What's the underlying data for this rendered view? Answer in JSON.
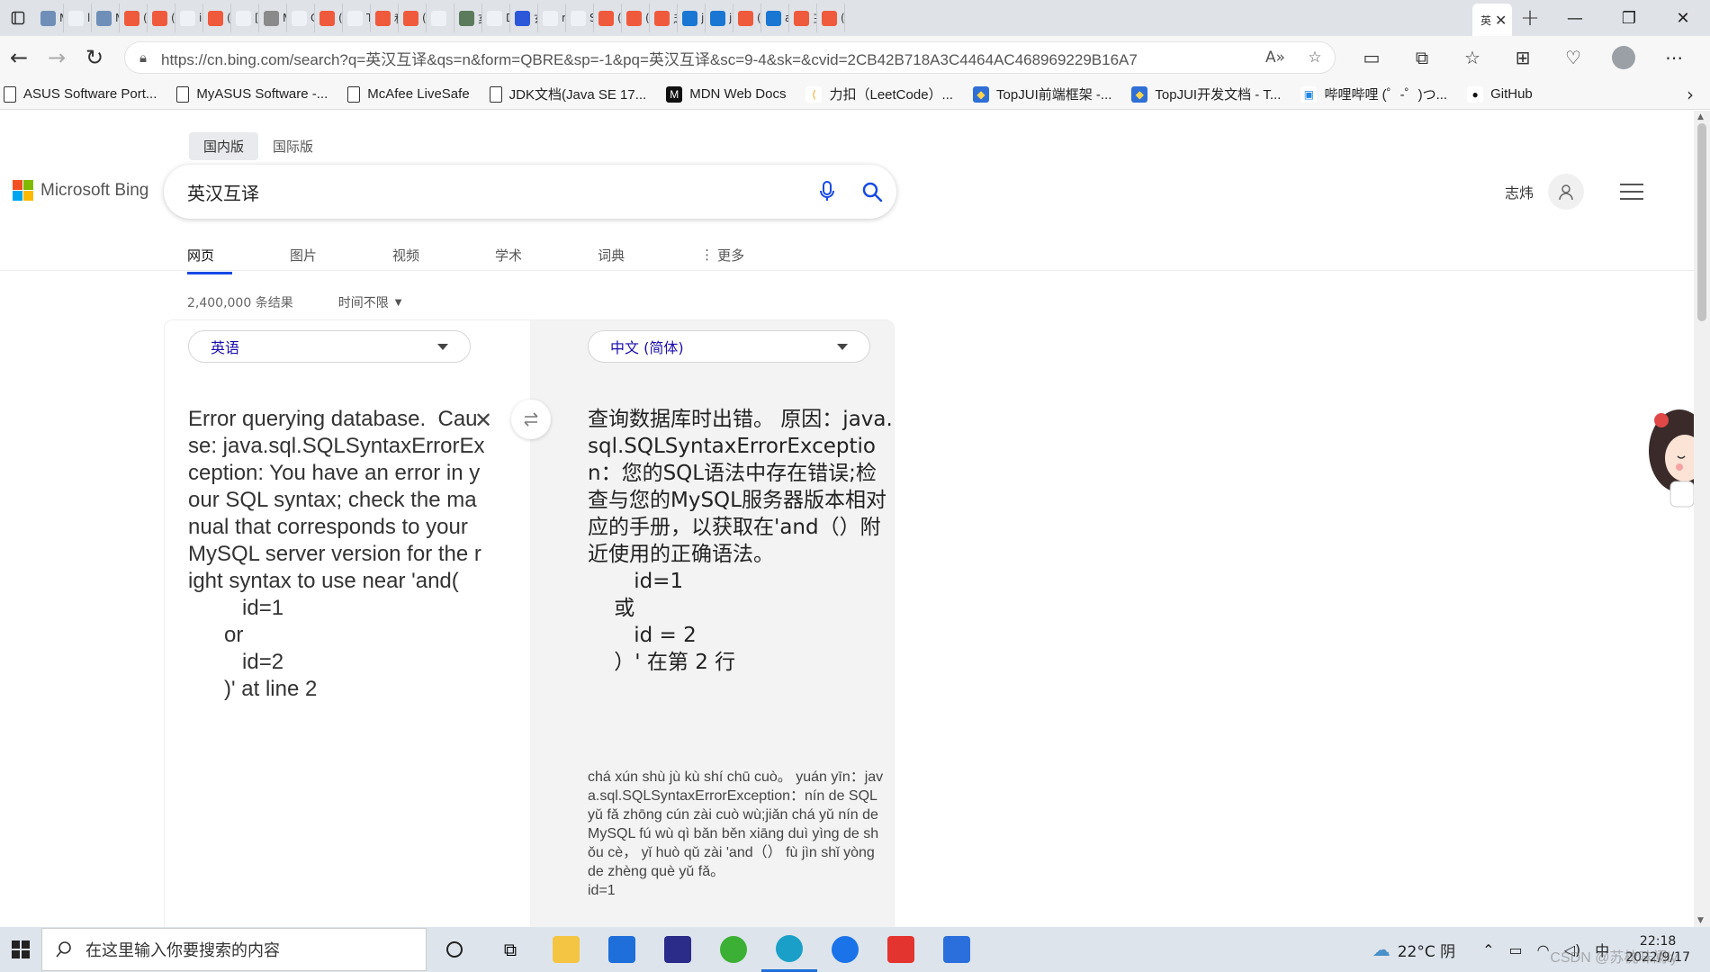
{
  "browser": {
    "url": "https://cn.bing.com/search?q=英汉互译&qs=n&form=QBRE&sp=-1&pq=英汉互译&sc=9-4&sk=&cvid=2CB42B718A3C4464AC468969229B16A7",
    "tabs": [
      {
        "fav": "#6f8fb8",
        "text": "M"
      },
      {
        "fav": "#eef2f6",
        "text": "lc"
      },
      {
        "fav": "#6f8fb8",
        "text": "M"
      },
      {
        "fav": "#f05a3c",
        "text": "("
      },
      {
        "fav": "#f05a3c",
        "text": "("
      },
      {
        "fav": "#eef2f6",
        "text": "ir"
      },
      {
        "fav": "#f05a3c",
        "text": "("
      },
      {
        "fav": "#eef2f6",
        "text": "["
      },
      {
        "fav": "#8a8a8a",
        "text": "M"
      },
      {
        "fav": "#eef2f6",
        "text": "C"
      },
      {
        "fav": "#f05a3c",
        "text": "("
      },
      {
        "fav": "#eef2f6",
        "text": "T"
      },
      {
        "fav": "#f05a3c",
        "text": "私"
      },
      {
        "fav": "#f05a3c",
        "text": "("
      },
      {
        "fav": "#eef2f6",
        "text": ""
      },
      {
        "fav": "#5c7a5c",
        "text": "亥"
      },
      {
        "fav": "#eef2f6",
        "text": "D"
      },
      {
        "fav": "#2b57d8",
        "text": "玄"
      },
      {
        "fav": "#eef2f6",
        "text": "n"
      },
      {
        "fav": "#eef2f6",
        "text": "S"
      },
      {
        "fav": "#f05a3c",
        "text": "("
      },
      {
        "fav": "#f05a3c",
        "text": "("
      },
      {
        "fav": "#f05a3c",
        "text": "乏"
      },
      {
        "fav": "#1976d2",
        "text": "ja"
      },
      {
        "fav": "#1976d2",
        "text": "ja"
      },
      {
        "fav": "#f05a3c",
        "text": "("
      },
      {
        "fav": "#1976d2",
        "text": "a"
      },
      {
        "fav": "#f05a3c",
        "text": "彐"
      },
      {
        "fav": "#f05a3c",
        "text": "("
      }
    ],
    "active_tab": {
      "text": "英"
    },
    "bookmarks": [
      {
        "label": "ASUS Software Port...",
        "kind": "doc"
      },
      {
        "label": "MyASUS Software -...",
        "kind": "doc"
      },
      {
        "label": "McAfee LiveSafe",
        "kind": "doc"
      },
      {
        "label": "JDK文档(Java SE 17...",
        "kind": "doc"
      },
      {
        "label": "MDN Web Docs",
        "kind": "mdn"
      },
      {
        "label": "力扣（LeetCode）...",
        "kind": "leetcode"
      },
      {
        "label": "TopJUI前端框架 -...",
        "kind": "topjui"
      },
      {
        "label": "TopJUI开发文档 - T...",
        "kind": "topjui"
      },
      {
        "label": "哔哩哔哩 (゜-゜)つ...",
        "kind": "bili"
      },
      {
        "label": "GitHub",
        "kind": "github"
      }
    ]
  },
  "bing": {
    "scope_tabs": [
      "国内版",
      "国际版"
    ],
    "logo_text": "Microsoft Bing",
    "query": "英汉互译",
    "username": "志炜",
    "vertical_tabs": [
      "网页",
      "图片",
      "视频",
      "学术",
      "词典",
      "更多"
    ],
    "result_count": "2,400,000 条结果",
    "time_filter": "时间不限"
  },
  "translator": {
    "source_lang": "英语",
    "target_lang": "中文 (简体)",
    "source_text": "Error querying database.  Cause: java.sql.SQLSyntaxErrorException: You have an error in your SQL syntax; check the manual that corresponds to your MySQL server version for the right syntax to use near 'and(\n         id=1\n      or\n         id=2\n      )' at line 2",
    "target_text": "查询数据库时出错。 原因：java.sql.SQLSyntaxErrorException：您的SQL语法中存在错误;检查与您的MySQL服务器版本相对应的手册，以获取在'and（）附近使用的正确语法。\n       id=1\n    或\n       id = 2\n    ）' 在第 2 行",
    "pinyin": "chá xún shù jù kù shí chū cuò。 yuán yīn：java.sql.SQLSyntaxErrorException：nín de SQL yǔ fǎ zhōng cún zài cuò wù;jiǎn chá yǔ nín de MySQL fú wù qì bǎn běn xiāng duì yìng de shǒu cè， yǐ huò qǔ zài 'and（） fù jìn shǐ yòng de zhèng què yǔ fǎ。\nid=1"
  },
  "taskbar": {
    "search_placeholder": "在这里输入你要搜索的内容",
    "weather": "22°C 阴",
    "ime": "中",
    "time": "22:18",
    "date": "2022/9/17",
    "watermark": "CSDN @苏枕味阑ly"
  },
  "colors": {
    "bing_blue": "#174ae4",
    "link": "#1a0dab",
    "ms_red": "#f25022",
    "ms_green": "#7fba00",
    "ms_blue": "#00a4ef",
    "ms_yellow": "#ffb900"
  }
}
